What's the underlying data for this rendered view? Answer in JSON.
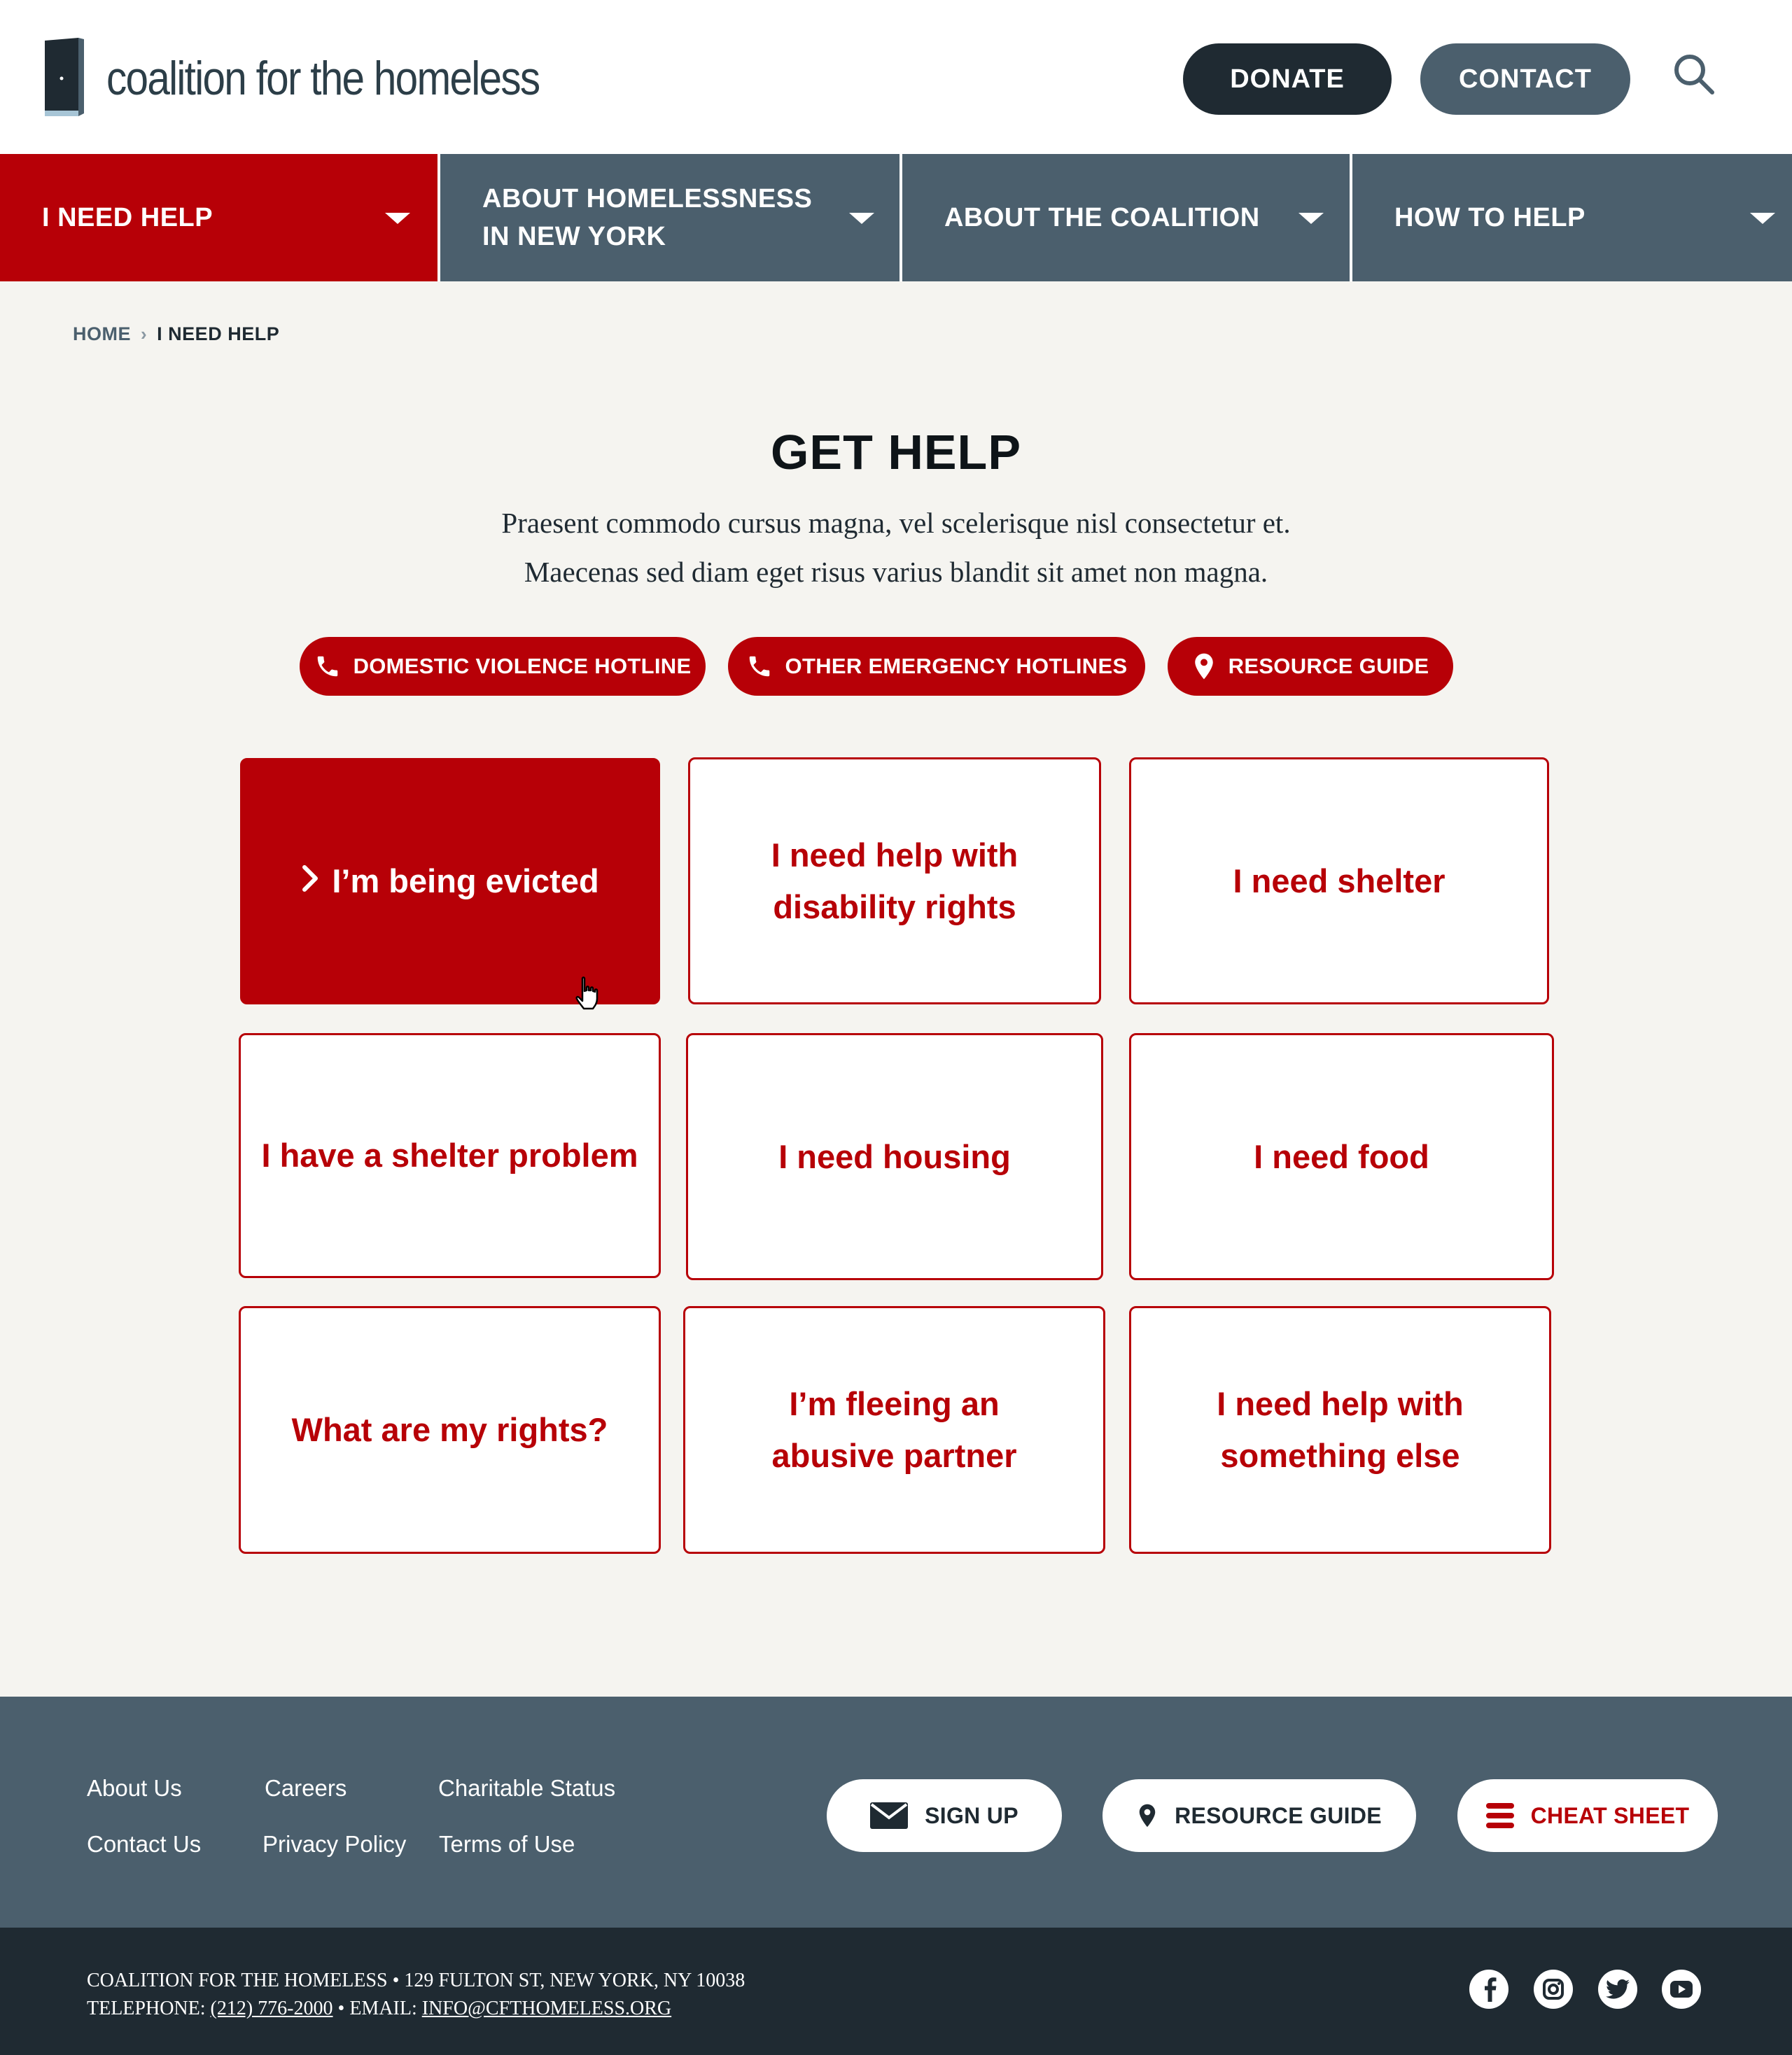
{
  "header": {
    "logo_text": "coalition for the homeless",
    "donate_label": "DONATE",
    "contact_label": "CONTACT"
  },
  "nav": {
    "items": [
      {
        "label": "I NEED HELP",
        "active": true
      },
      {
        "label": "ABOUT HOMELESSNESS IN NEW YORK",
        "active": false
      },
      {
        "label": "ABOUT THE COALITION",
        "active": false
      },
      {
        "label": "HOW TO HELP",
        "active": false
      }
    ]
  },
  "breadcrumb": {
    "home": "HOME",
    "separator": "›",
    "current": "I NEED HELP"
  },
  "hero": {
    "title": "GET HELP",
    "intro_line1": "Praesent commodo cursus magna, vel scelerisque nisl consectetur et.",
    "intro_line2": "Maecenas sed diam eget risus varius blandit sit amet non magna."
  },
  "quick_links": [
    {
      "label": "DOMESTIC VIOLENCE HOTLINE",
      "icon": "phone-icon"
    },
    {
      "label": "OTHER EMERGENCY HOTLINES",
      "icon": "phone-icon"
    },
    {
      "label": "RESOURCE GUIDE",
      "icon": "map-pin-icon"
    }
  ],
  "cards": [
    {
      "label": "I’m being evicted",
      "active": true
    },
    {
      "label": "I need help with disability rights",
      "active": false
    },
    {
      "label": "I need shelter",
      "active": false
    },
    {
      "label": "I have a shelter problem",
      "active": false
    },
    {
      "label": "I need housing",
      "active": false
    },
    {
      "label": "I need food",
      "active": false
    },
    {
      "label": "What are my rights?",
      "active": false
    },
    {
      "label": "I’m fleeing an abusive partner",
      "active": false
    },
    {
      "label": "I need help with something else",
      "active": false
    }
  ],
  "footer": {
    "links": [
      "About Us",
      "Careers",
      "Charitable Status",
      "Contact Us",
      "Privacy Policy",
      "Terms of Use"
    ],
    "signup_label": "SIGN UP",
    "resource_label": "RESOURCE GUIDE",
    "cheat_label": "CHEAT SHEET",
    "address_line": "COALITION FOR THE HOMELESS • 129 FULTON ST, NEW YORK, NY 10038",
    "telephone_prefix": "TELEPHONE:",
    "telephone": "(212) 776-2000",
    "email_prefix": "• EMAIL:",
    "email": "INFO@CFTHOMELESS.ORG",
    "social": [
      "facebook-icon",
      "instagram-icon",
      "twitter-icon",
      "youtube-icon"
    ]
  },
  "colors": {
    "brand_red": "#b70007",
    "slate": "#4b5f6d",
    "dark": "#1f2a32",
    "page_bg": "#f5f4f0"
  }
}
